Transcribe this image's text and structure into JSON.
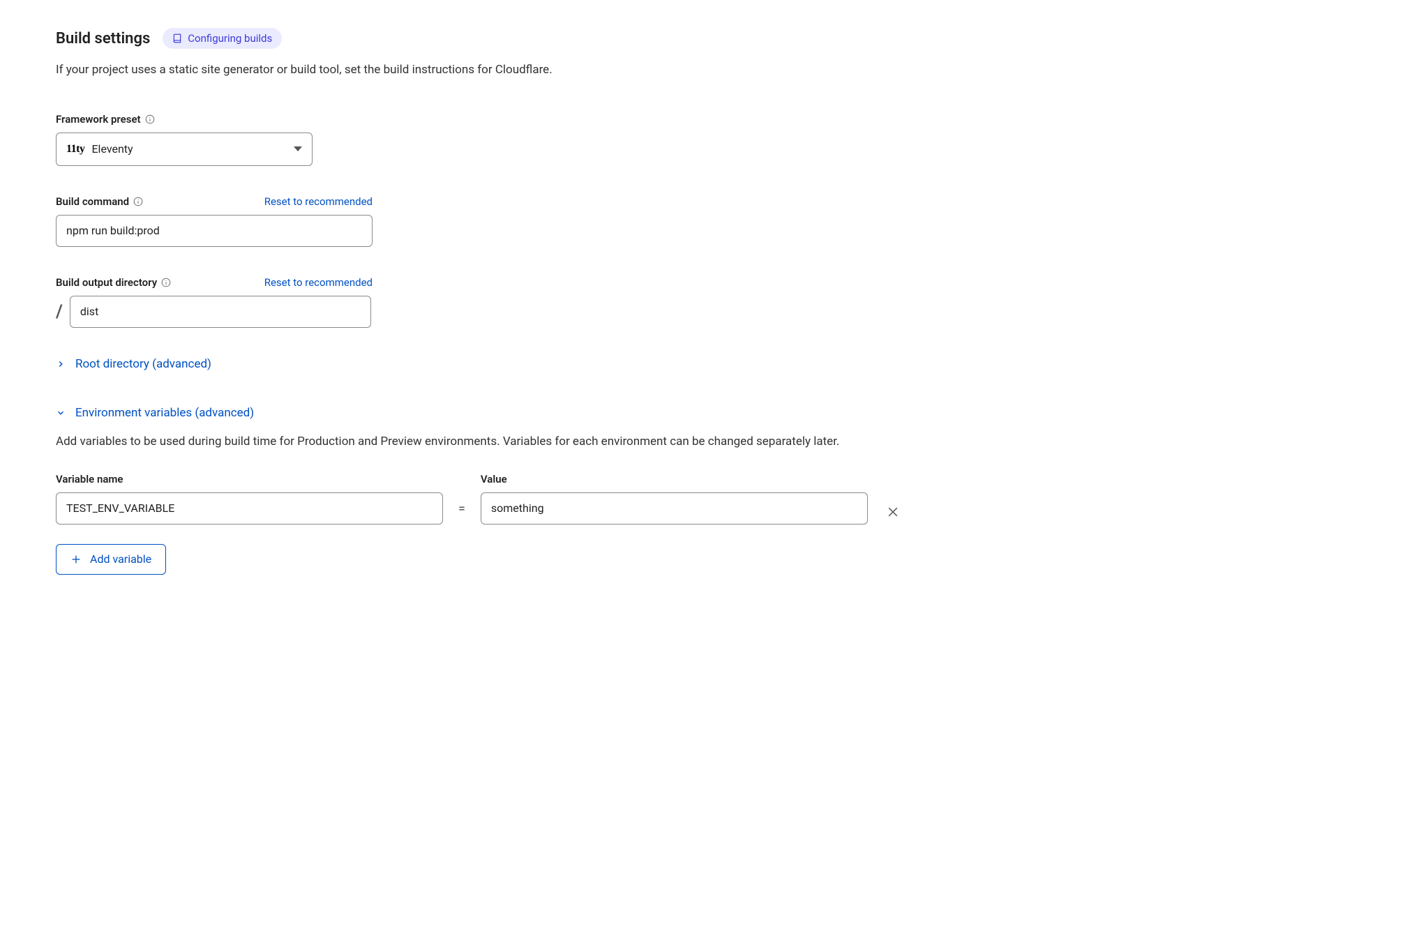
{
  "section": {
    "title": "Build settings",
    "badge_label": "Configuring builds",
    "description": "If your project uses a static site generator or build tool, set the build instructions for Cloudflare."
  },
  "framework": {
    "label": "Framework preset",
    "logo_text": "11ty",
    "selected": "Eleventy"
  },
  "build_command": {
    "label": "Build command",
    "reset_label": "Reset to recommended",
    "value": "npm run build:prod"
  },
  "output_dir": {
    "label": "Build output directory",
    "reset_label": "Reset to recommended",
    "prefix": "/",
    "value": "dist"
  },
  "root_dir": {
    "label": "Root directory (advanced)"
  },
  "env": {
    "label": "Environment variables (advanced)",
    "description": "Add variables to be used during build time for Production and Preview environments. Variables for each environment can be changed separately later.",
    "name_label": "Variable name",
    "value_label": "Value",
    "equals": "=",
    "rows": [
      {
        "name": "TEST_ENV_VARIABLE",
        "value": "something"
      }
    ],
    "add_button": "Add variable"
  }
}
